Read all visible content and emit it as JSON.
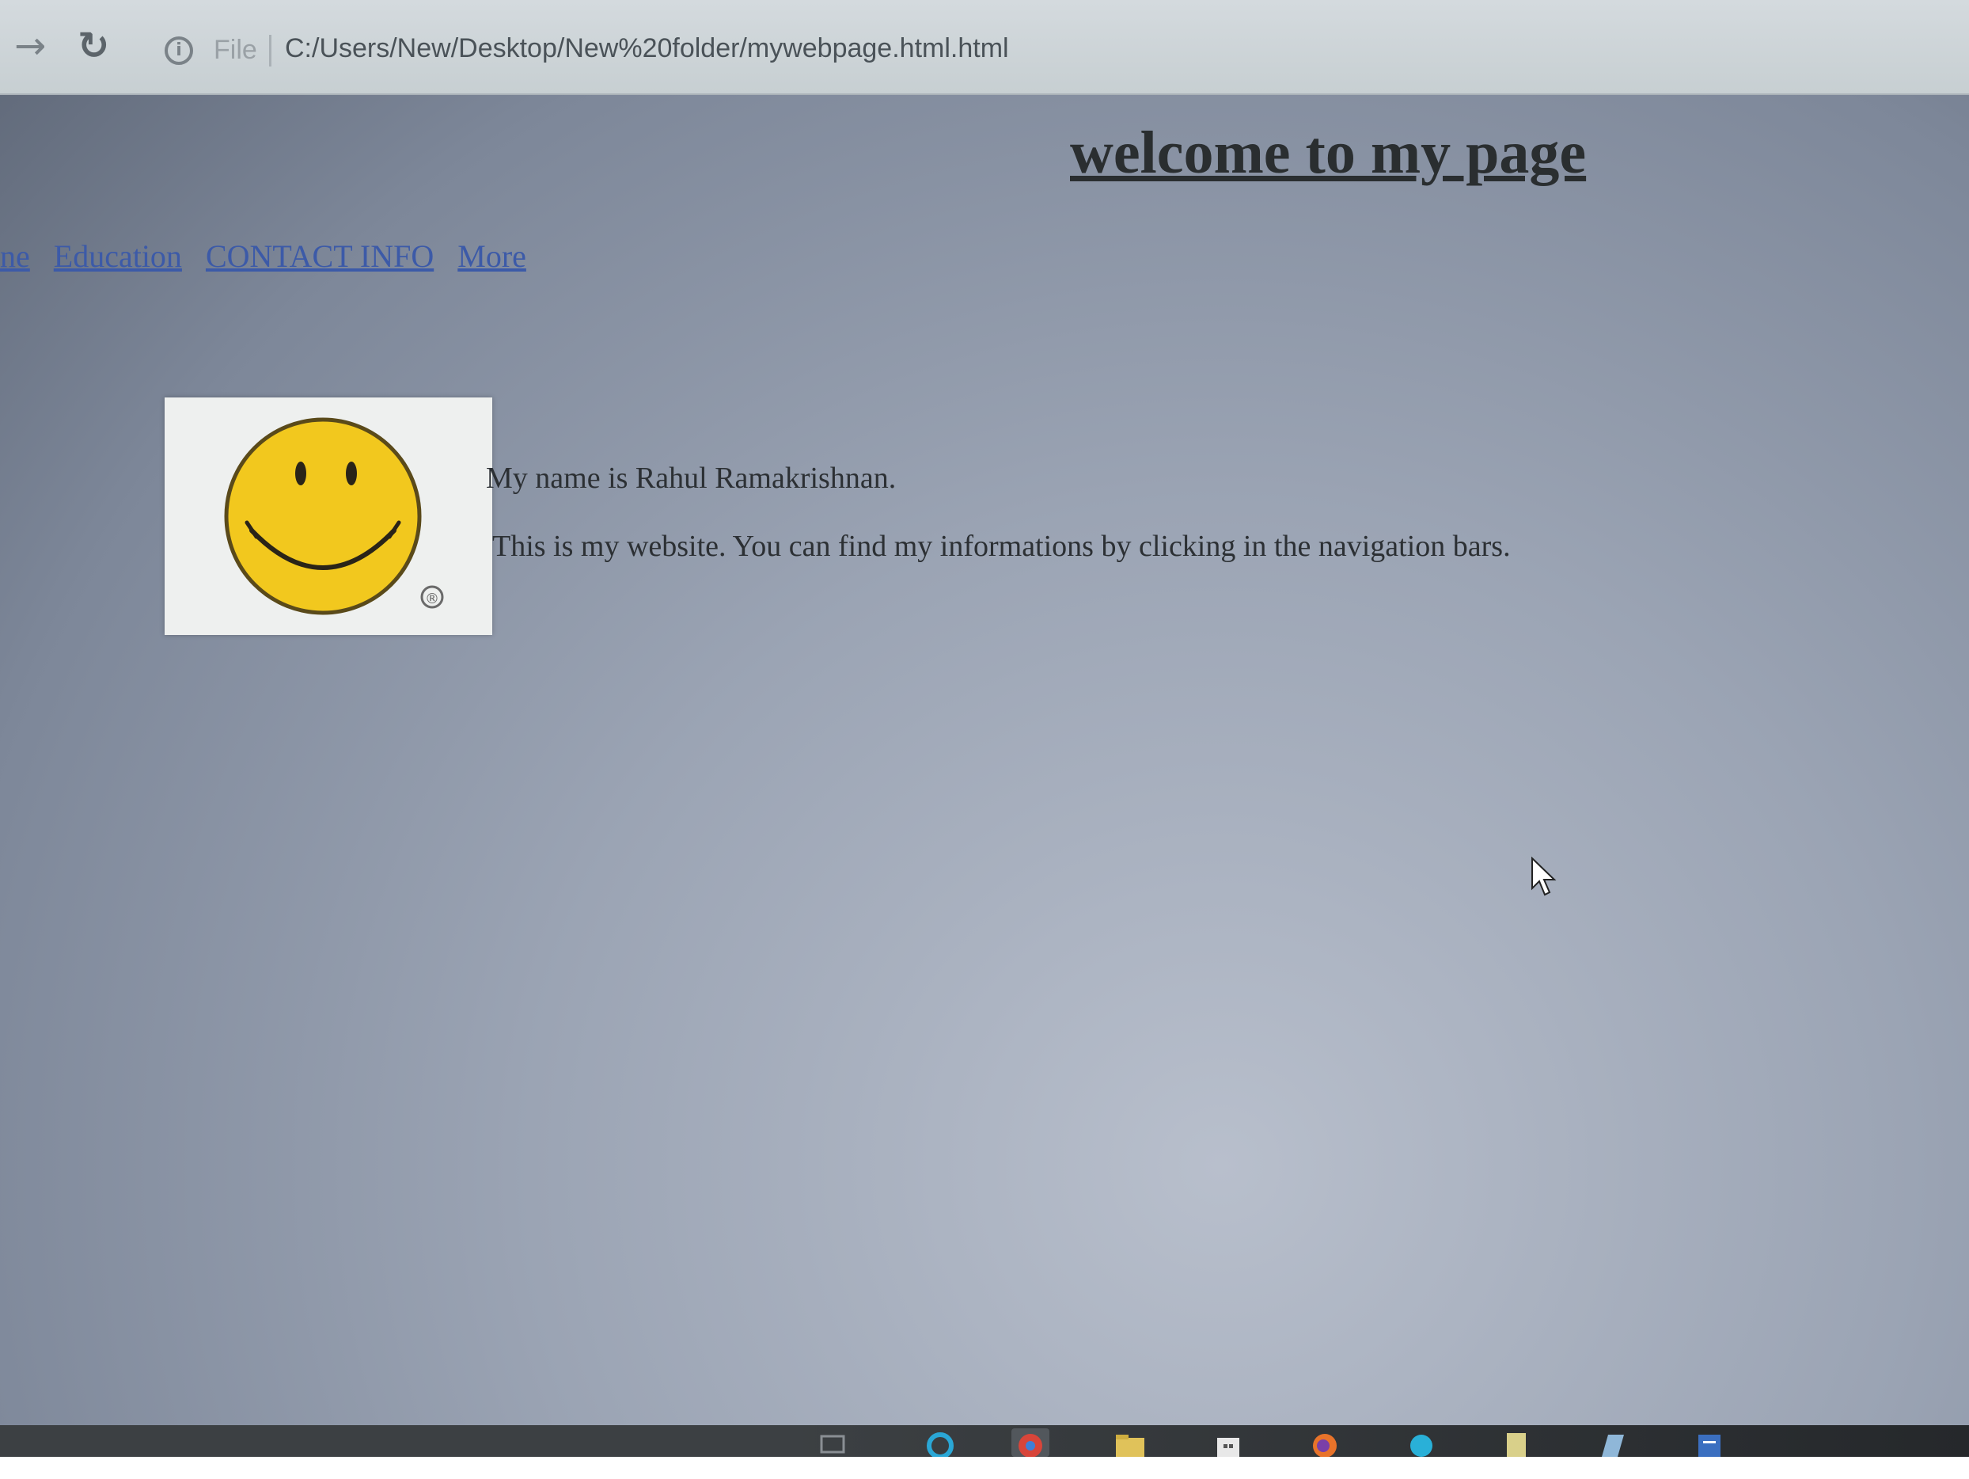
{
  "browser": {
    "forward_icon": "arrow-right-icon",
    "reload_icon": "reload-icon",
    "info_icon": "info-icon",
    "scheme_label": "File",
    "url": "C:/Users/New/Desktop/New%20folder/mywebpage.html.html"
  },
  "page": {
    "heading": "welcome to my page",
    "nav_links": [
      "ne",
      "Education",
      "CONTACT INFO",
      "More"
    ],
    "intro_name": "My name is Rahul Ramakrishnan.",
    "intro_text": "This is my website. You can find my informations by clicking in the navigation bars.",
    "image_icon": "smiley-face-icon",
    "image_mark": "®"
  },
  "taskbar": {
    "items": [
      {
        "icon": "task-view-icon",
        "color": "#6b7075"
      },
      {
        "icon": "cortana-icon",
        "color": "#2aa7d6"
      },
      {
        "icon": "chrome-icon",
        "color": "#d8453a"
      },
      {
        "icon": "file-explorer-icon",
        "color": "#e0c25a"
      },
      {
        "icon": "store-icon",
        "color": "#e8e8e8"
      },
      {
        "icon": "firefox-icon",
        "color": "#e8732a"
      },
      {
        "icon": "skype-icon",
        "color": "#29b0d8"
      },
      {
        "icon": "notepad-icon",
        "color": "#d9d08a"
      },
      {
        "icon": "app-icon",
        "color": "#8fb7d8"
      },
      {
        "icon": "word-icon",
        "color": "#3b6fc0"
      }
    ]
  },
  "colors": {
    "link": "#3c5aa8",
    "smiley_yellow": "#f2c81e",
    "taskbar": "#3c4043"
  }
}
